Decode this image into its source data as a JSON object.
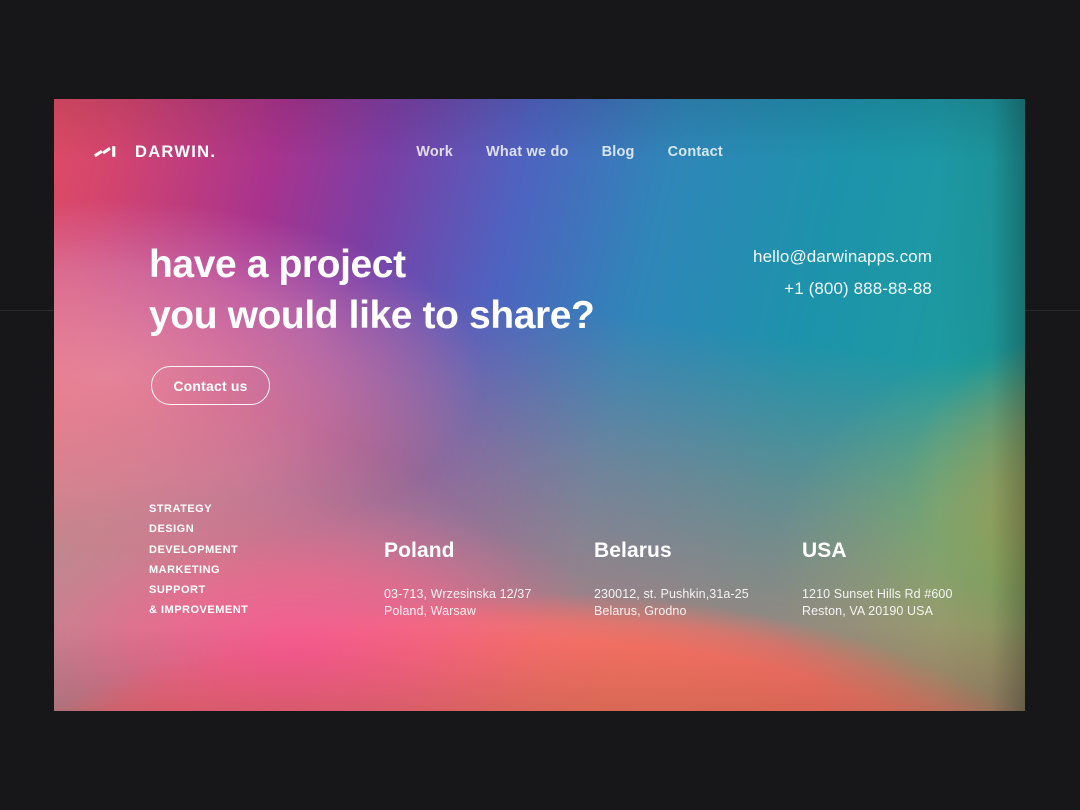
{
  "brand": {
    "name": "DARWIN.",
    "logo_icon": "darwin-zigzag-mark"
  },
  "nav": {
    "items": [
      {
        "label": "Work"
      },
      {
        "label": "What we do"
      },
      {
        "label": "Blog"
      },
      {
        "label": "Contact"
      }
    ]
  },
  "hero": {
    "headline_line1": "have a project",
    "headline_line2": "you would like to share?",
    "cta_label": "Contact us"
  },
  "contacts": {
    "email": "hello@darwinapps.com",
    "phone": "+1 (800) 888-88-88"
  },
  "services": {
    "items": [
      {
        "label": "STRATEGY"
      },
      {
        "label": "DESIGN"
      },
      {
        "label": "DEVELOPMENT"
      },
      {
        "label": "MARKETING"
      },
      {
        "label": "SUPPORT"
      },
      {
        "label": "& IMPROVEMENT"
      }
    ]
  },
  "offices": [
    {
      "name": "Poland",
      "address_line1": "03-713, Wrzesinska 12/37",
      "address_line2": "Poland, Warsaw"
    },
    {
      "name": "Belarus",
      "address_line1": "230012, st. Pushkin,31a-25",
      "address_line2": "Belarus, Grodno"
    },
    {
      "name": "USA",
      "address_line1": "1210 Sunset Hills Rd #600",
      "address_line2": "Reston, VA 20190 USA"
    }
  ],
  "colors": {
    "page_background": "#171719",
    "text_primary": "#ffffff",
    "gradient_red": "#e8515f",
    "gradient_magenta": "#ff28d7",
    "gradient_purple": "#a8338e",
    "gradient_blue": "#56a0dd",
    "gradient_teal": "#1d93ab",
    "gradient_green": "#38cd5a",
    "gradient_coral": "#fb8266",
    "gradient_gold": "#d4b246"
  }
}
